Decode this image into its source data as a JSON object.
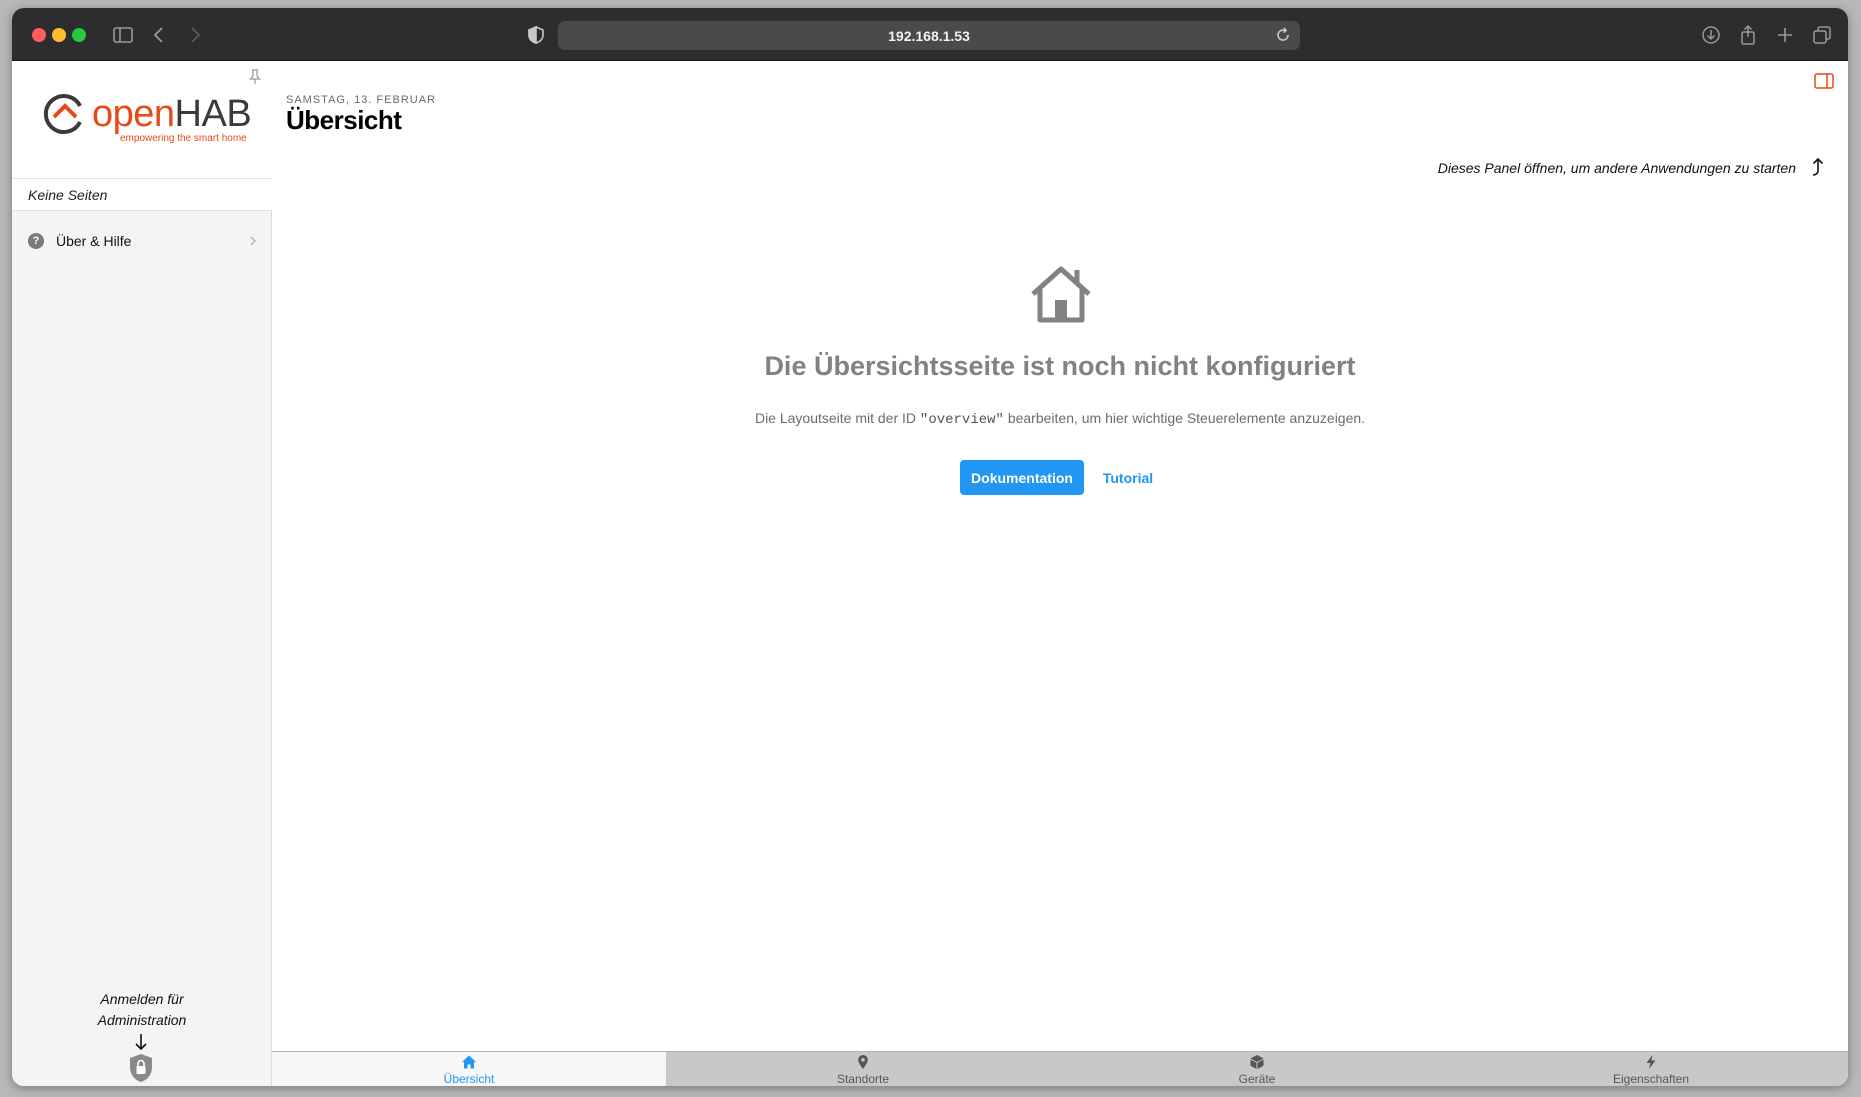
{
  "browser": {
    "url": "192.168.1.53"
  },
  "sidebar": {
    "logo_open": "open",
    "logo_hab": "HAB",
    "logo_tagline": "empowering the smart home",
    "no_pages": "Keine Seiten",
    "items": [
      {
        "label": "Über & Hilfe",
        "icon": "question-icon"
      }
    ],
    "login_hint_line1": "Anmelden für",
    "login_hint_line2": "Administration"
  },
  "main": {
    "date": "SAMSTAG, 13. FEBRUAR",
    "title": "Übersicht",
    "panel_hint": "Dieses Panel öffnen, um andere Anwendungen zu starten",
    "empty_title": "Die Übersichtsseite ist noch nicht konfiguriert",
    "empty_desc_before": "Die Layoutseite mit der ID ",
    "empty_desc_code": "\"overview\"",
    "empty_desc_after": " bearbeiten, um hier wichtige Steuerelemente anzuzeigen.",
    "doc_button": "Dokumentation",
    "tutorial_button": "Tutorial"
  },
  "tabbar": {
    "tabs": [
      {
        "label": "Übersicht",
        "icon": "home-icon",
        "active": true
      },
      {
        "label": "Standorte",
        "icon": "location-icon",
        "active": false
      },
      {
        "label": "Geräte",
        "icon": "cube-icon",
        "active": false
      },
      {
        "label": "Eigenschaften",
        "icon": "bolt-icon",
        "active": false
      }
    ]
  },
  "colors": {
    "accent": "#2196f3",
    "brand_orange": "#e64a19"
  }
}
